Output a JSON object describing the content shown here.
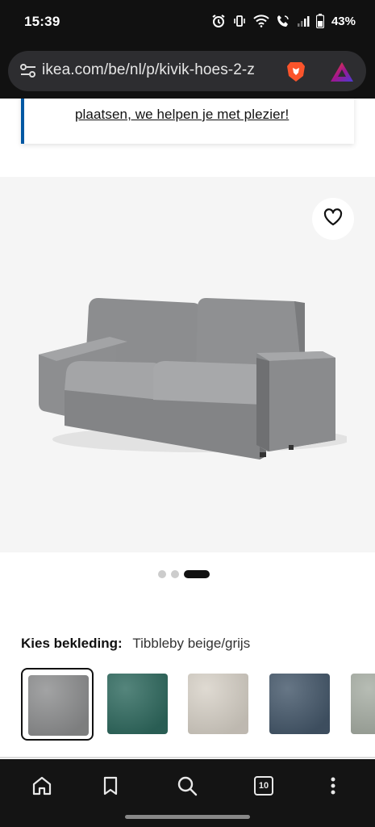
{
  "status_bar": {
    "time": "15:39",
    "battery": "43%"
  },
  "browser": {
    "url": "ikea.com/be/nl/p/kivik-hoes-2-z",
    "tab_count": "10"
  },
  "notice": {
    "link_text": "plaatsen, we helpen je met plezier!"
  },
  "gallery": {
    "dot_count": 3,
    "active_dot": 3
  },
  "upholstery": {
    "label": "Kies bekleding:",
    "value": "Tibbleby beige/grijs",
    "swatches": [
      {
        "color": "#8e8f90",
        "selected": true
      },
      {
        "color": "#2f6a5f",
        "selected": false
      },
      {
        "color": "#d8d2c8",
        "selected": false
      },
      {
        "color": "#45586b",
        "selected": false
      },
      {
        "color": "#a7aea4",
        "selected": false
      }
    ]
  },
  "colors": {
    "ikea_blue": "#0058a3"
  }
}
